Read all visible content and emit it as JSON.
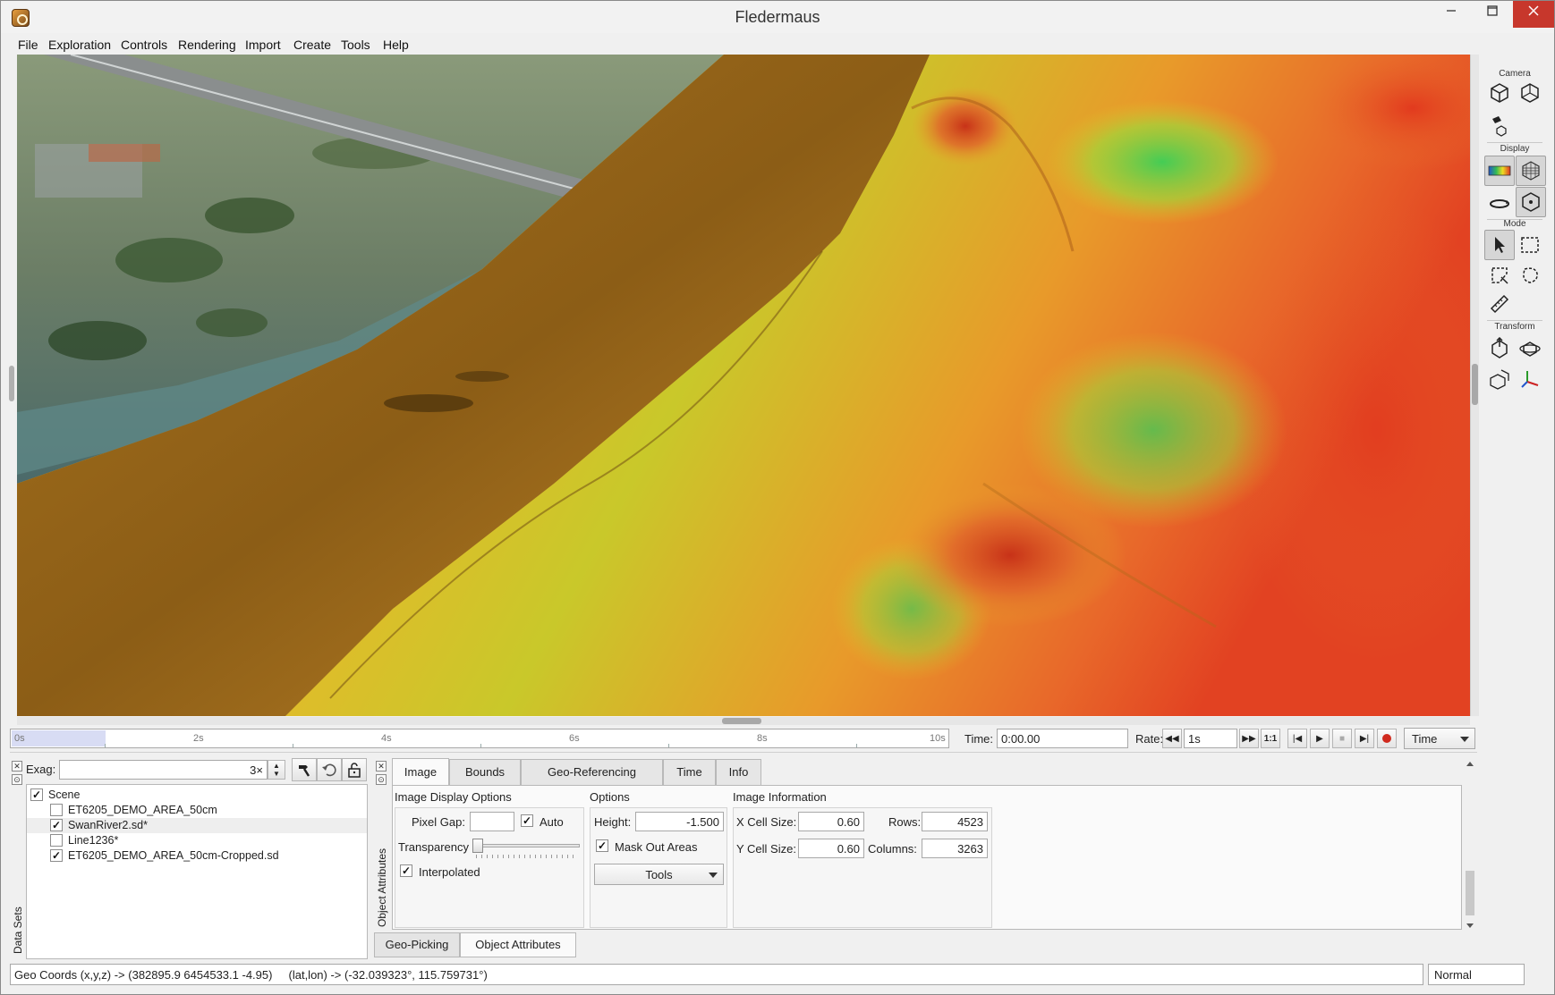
{
  "window": {
    "title": "Fledermaus"
  },
  "menu": [
    "File",
    "Exploration",
    "Controls",
    "Rendering",
    "Import",
    "Create",
    "Tools",
    "Help"
  ],
  "toolbar": {
    "groups": {
      "camera": "Camera",
      "display": "Display",
      "mode": "Mode",
      "transform": "Transform"
    }
  },
  "timeline": {
    "ticks": [
      "0s",
      "2s",
      "4s",
      "6s",
      "8s",
      "10s"
    ],
    "played_fraction": 0.1,
    "time_label": "Time:",
    "time_value": "0:00.00",
    "rate_label": "Rate:",
    "rate_value": "1s",
    "ratio_label": "1:1",
    "mode_value": "Time"
  },
  "datasets": {
    "panel_label": "Data Sets",
    "exag_label": "Exag:",
    "exag_value": "3×",
    "items": [
      {
        "label": "Scene",
        "checked": true,
        "indent": 0,
        "selected": false
      },
      {
        "label": "ET6205_DEMO_AREA_50cm",
        "checked": false,
        "indent": 1,
        "selected": false
      },
      {
        "label": "SwanRiver2.sd*",
        "checked": true,
        "indent": 1,
        "selected": true
      },
      {
        "label": "Line1236*",
        "checked": false,
        "indent": 1,
        "selected": false
      },
      {
        "label": "ET6205_DEMO_AREA_50cm-Cropped.sd",
        "checked": true,
        "indent": 1,
        "selected": false
      }
    ]
  },
  "attributes": {
    "side_label": "Object Attributes",
    "tabs": [
      "Image",
      "Bounds",
      "Geo-Referencing",
      "Time",
      "Info"
    ],
    "active_tab": "Image",
    "image_display": {
      "title": "Image Display Options",
      "pixel_gap_label": "Pixel Gap:",
      "pixel_gap_value": "",
      "auto_label": "Auto",
      "auto_checked": true,
      "transparency_label": "Transparency",
      "transparency_level": 0,
      "interpolated_label": "Interpolated",
      "interpolated_checked": true
    },
    "options": {
      "title": "Options",
      "height_label": "Height:",
      "height_value": "-1.500",
      "mask_label": "Mask Out Areas",
      "mask_checked": true,
      "tools_label": "Tools"
    },
    "image_info": {
      "title": "Image Information",
      "x_cell_label": "X Cell Size:",
      "x_cell_value": "0.60",
      "y_cell_label": "Y Cell Size:",
      "y_cell_value": "0.60",
      "rows_label": "Rows:",
      "rows_value": "4523",
      "columns_label": "Columns:",
      "columns_value": "3263"
    }
  },
  "bottom_tabs": [
    "Geo-Picking",
    "Object Attributes"
  ],
  "status": {
    "coords": "Geo Coords (x,y,z) -> (382895.9 6454533.1 -4.95)     (lat,lon) -> (-32.039323°, 115.759731°)",
    "mode": "Normal"
  },
  "colors": {
    "accent_close": "#c7372c",
    "terrain_high": "#e03a1e",
    "terrain_mid": "#e8c020",
    "terrain_low": "#4cc850",
    "sidescan": "#b07a22"
  }
}
